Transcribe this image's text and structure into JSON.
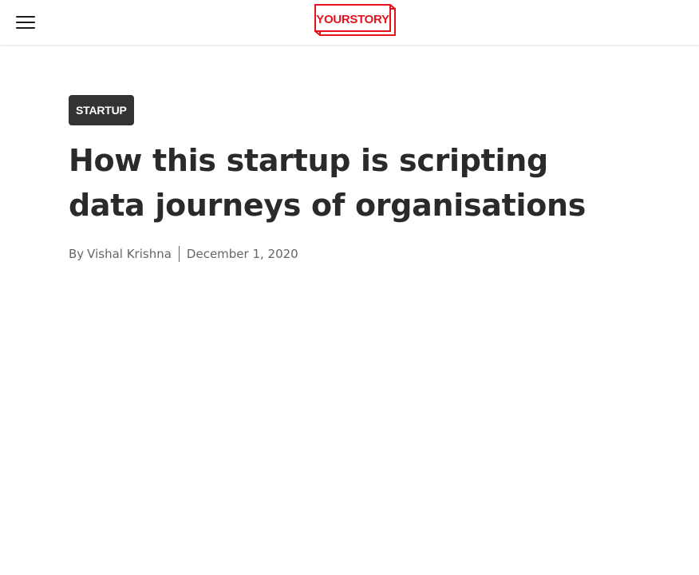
{
  "header": {
    "logo_text": "YOURSTORY",
    "brand_color": "#e5131d"
  },
  "article": {
    "category": "STARTUP",
    "title": "How this startup is scripting data journeys of organisations",
    "byline_prefix": "By",
    "author": "Vishal Krishna",
    "date": "December 1, 2020"
  },
  "icons": {
    "menu": "hamburger-menu-icon"
  }
}
